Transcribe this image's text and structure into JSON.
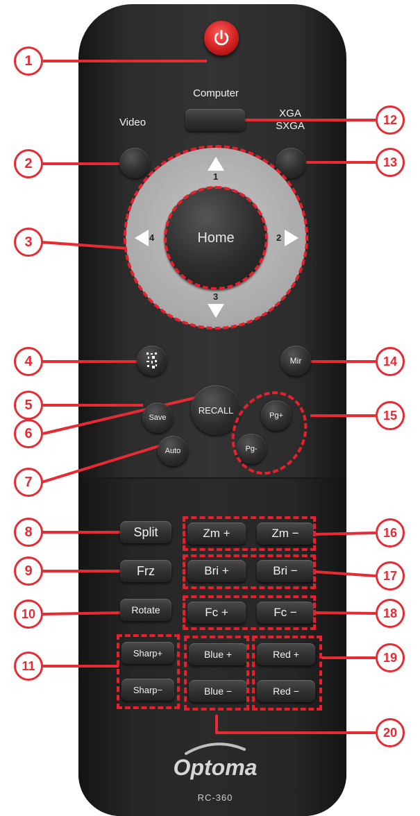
{
  "remote": {
    "buttons": {
      "computer": "Computer",
      "video": "Video",
      "xga_line1": "XGA",
      "xga_line2": "SXGA",
      "home": "Home",
      "mir": "Mir",
      "save": "Save",
      "recall": "RECALL",
      "pg_up": "Pg+",
      "pg_down": "Pg-",
      "auto": "Auto",
      "split": "Split",
      "frz": "Frz",
      "rotate": "Rotate",
      "zm_plus": "Zm +",
      "zm_minus": "Zm −",
      "bri_plus": "Bri +",
      "bri_minus": "Bri −",
      "fc_plus": "Fc +",
      "fc_minus": "Fc −",
      "sharp_plus": "Sharp+",
      "sharp_minus": "Sharp−",
      "blue_plus": "Blue +",
      "blue_minus": "Blue −",
      "red_plus": "Red +",
      "red_minus": "Red −"
    },
    "dpad_numbers": [
      "1",
      "2",
      "3",
      "4"
    ],
    "brand": "Optoma",
    "model": "RC-360",
    "icons": [
      "power-icon",
      "pattern-icon"
    ]
  },
  "callouts": [
    "1",
    "2",
    "3",
    "4",
    "5",
    "6",
    "7",
    "8",
    "9",
    "10",
    "11",
    "12",
    "13",
    "14",
    "15",
    "16",
    "17",
    "18",
    "19",
    "20"
  ],
  "colors": {
    "callout": "#e62b33",
    "remote_body": "#2e2e2e",
    "power": "#d12020"
  }
}
